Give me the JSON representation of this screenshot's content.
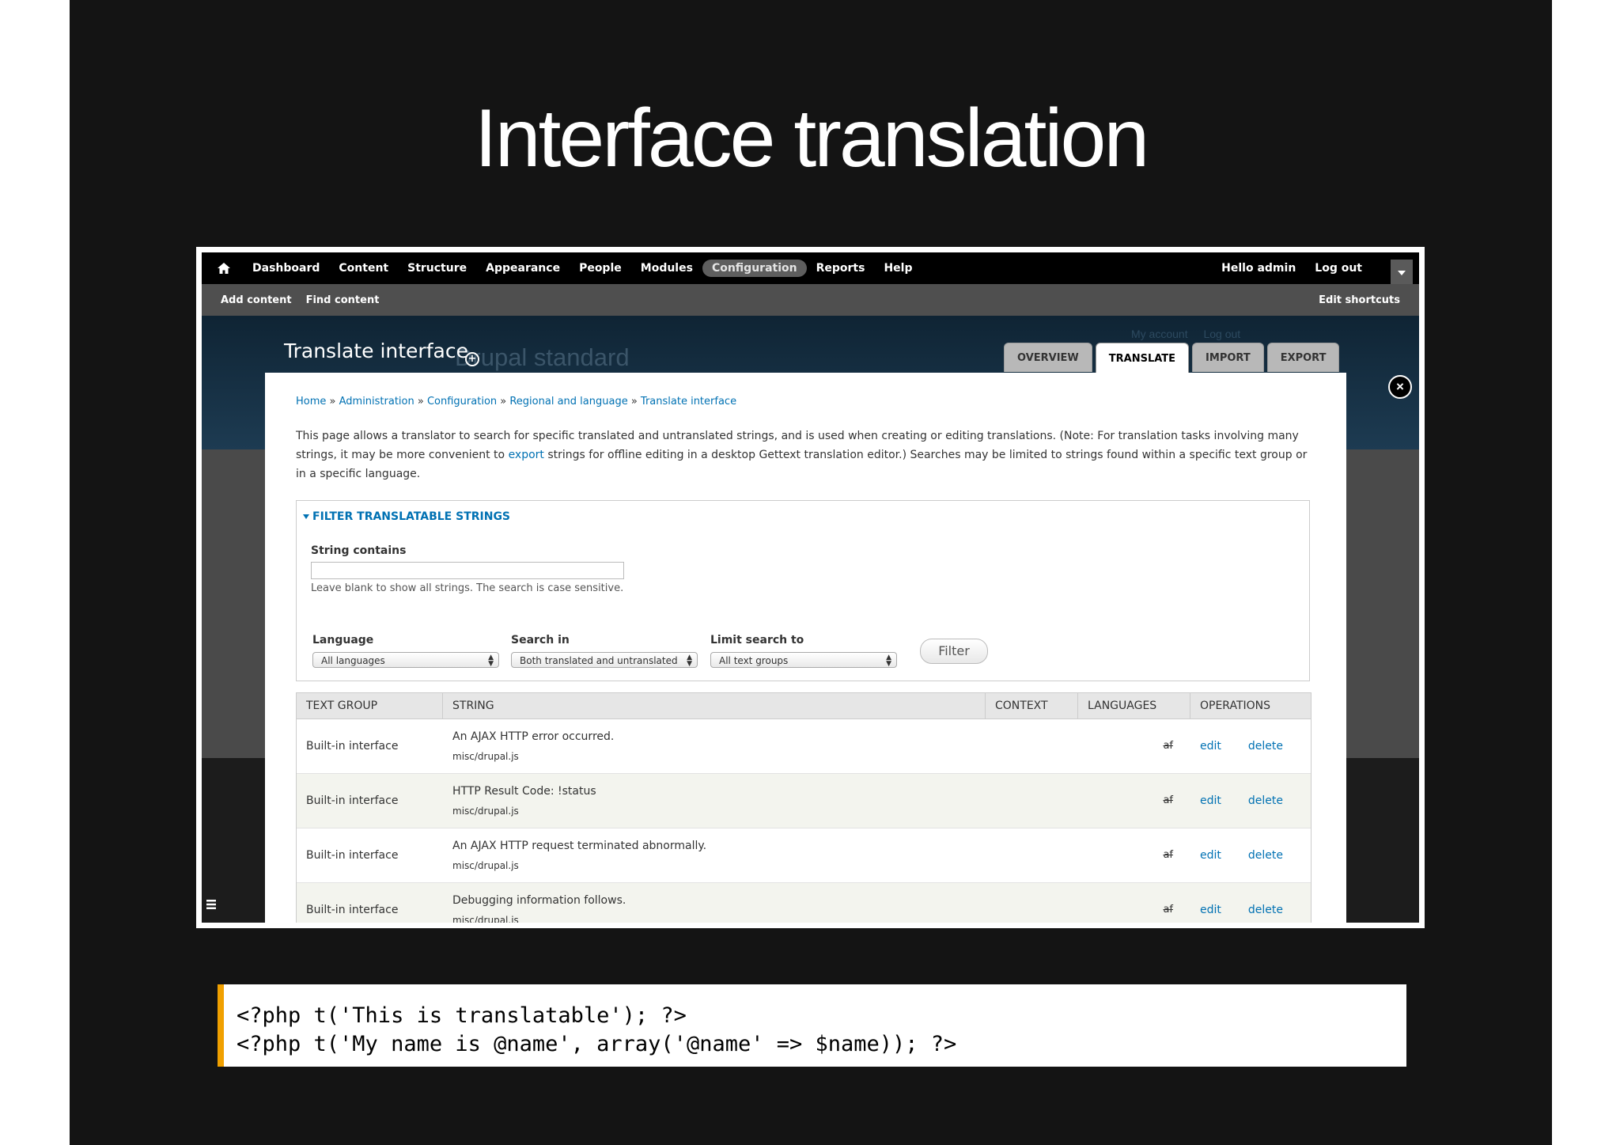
{
  "slide": {
    "title": "Interface translation"
  },
  "toolbar": {
    "menu": [
      "Dashboard",
      "Content",
      "Structure",
      "Appearance",
      "People",
      "Modules",
      "Configuration",
      "Reports",
      "Help"
    ],
    "active": "Configuration",
    "hello": "Hello admin",
    "logout": "Log out"
  },
  "shortcuts": {
    "items": [
      "Add content",
      "Find content"
    ],
    "edit": "Edit shortcuts"
  },
  "header": {
    "page_title": "Translate interface",
    "ghost_site_name": "Drupal standard",
    "ghost_links": [
      "My account",
      "Log out"
    ],
    "tabs": [
      "OVERVIEW",
      "TRANSLATE",
      "IMPORT",
      "EXPORT"
    ],
    "active_tab": "TRANSLATE"
  },
  "breadcrumb": [
    "Home",
    "Administration",
    "Configuration",
    "Regional and language",
    "Translate interface"
  ],
  "help": {
    "part1": "This page allows a translator to search for specific translated and untranslated strings, and is used when creating or editing translations. (Note: For translation tasks involving many strings, it may be more convenient to ",
    "link": "export",
    "part2": " strings for offline editing in a desktop Gettext translation editor.) Searches may be limited to strings found within a specific text group or in a specific language."
  },
  "filter": {
    "legend": "FILTER TRANSLATABLE STRINGS",
    "string_label": "String contains",
    "string_value": "",
    "string_desc": "Leave blank to show all strings. The search is case sensitive.",
    "language_label": "Language",
    "language_value": "All languages",
    "search_label": "Search in",
    "search_value": "Both translated and untranslated",
    "limit_label": "Limit search to",
    "limit_value": "All text groups",
    "button": "Filter"
  },
  "table": {
    "headers": [
      "TEXT GROUP",
      "STRING",
      "CONTEXT",
      "LANGUAGES",
      "OPERATIONS"
    ],
    "rows": [
      {
        "group": "Built-in interface",
        "string": "An AJAX HTTP error occurred.",
        "source": "misc/drupal.js",
        "lang": "af",
        "edit": "edit",
        "delete": "delete"
      },
      {
        "group": "Built-in interface",
        "string": "HTTP Result Code: !status",
        "source": "misc/drupal.js",
        "lang": "af",
        "edit": "edit",
        "delete": "delete"
      },
      {
        "group": "Built-in interface",
        "string": "An AJAX HTTP request terminated abnormally.",
        "source": "misc/drupal.js",
        "lang": "af",
        "edit": "edit",
        "delete": "delete"
      },
      {
        "group": "Built-in interface",
        "string": "Debugging information follows.",
        "source": "misc/drupal.js",
        "lang": "af",
        "edit": "edit",
        "delete": "delete"
      }
    ]
  },
  "code": {
    "line1": "<?php t('This is translatable'); ?>",
    "line2": "<?php t('My name is @name', array('@name' => $name)); ?>"
  },
  "colors": {
    "link": "#0071b3",
    "accent": "#f0a000",
    "slide_bg": "#141414"
  }
}
